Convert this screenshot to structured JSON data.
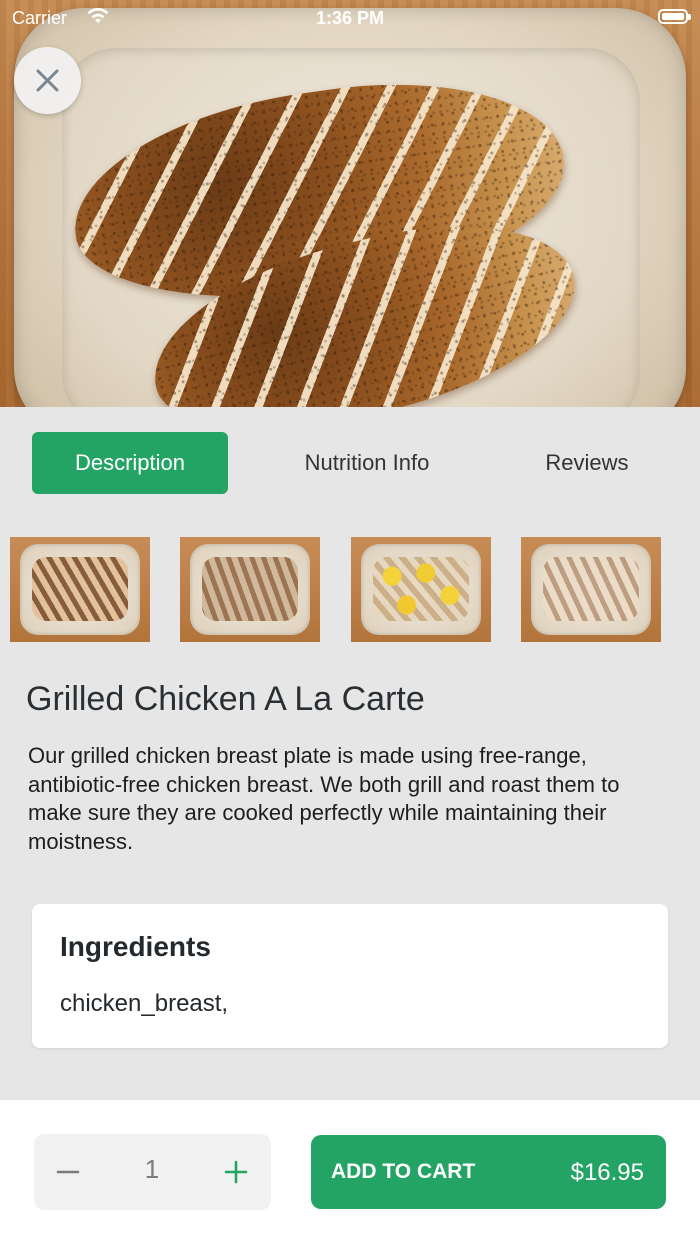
{
  "status_bar": {
    "carrier": "Carrier",
    "time": "1:36 PM"
  },
  "tabs": [
    {
      "label": "Description",
      "active": true
    },
    {
      "label": "Nutrition Info",
      "active": false
    },
    {
      "label": "Reviews",
      "active": false
    }
  ],
  "product": {
    "title": "Grilled Chicken A La Carte",
    "description": "Our grilled chicken breast plate is made using free-range, antibiotic-free chicken breast.  We both grill and roast them to make sure they are cooked perfectly while maintaining their moistness."
  },
  "ingredients": {
    "title": "Ingredients",
    "list": "chicken_breast,"
  },
  "cart": {
    "quantity": "1",
    "add_label": "ADD TO CART",
    "price": "$16.95"
  },
  "colors": {
    "accent": "#23a465",
    "background": "#e6e6e6"
  },
  "icons": [
    "close-icon",
    "wifi-icon",
    "battery-icon",
    "minus-icon",
    "plus-icon"
  ]
}
